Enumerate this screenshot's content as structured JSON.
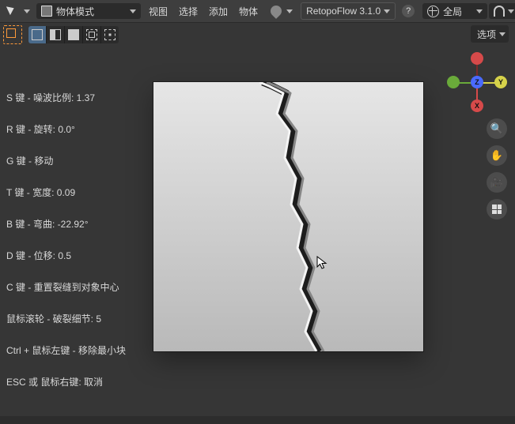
{
  "header": {
    "mode_label": "物体模式",
    "menus": {
      "view": "视图",
      "select": "选择",
      "add": "添加",
      "object": "物体"
    },
    "addon_label": "RetopoFlow 3.1.0",
    "orientation_label": "全局"
  },
  "options": {
    "label": "选项"
  },
  "gizmo": {
    "x": "X",
    "y": "Y",
    "z": "Z"
  },
  "hints": {
    "noise": "S 键 - 噪波比例:  1.37",
    "rotate": "R 键 - 旋转:  0.0°",
    "move": "G 键 - 移动",
    "width": "T 键 - 宽度:  0.09",
    "bend": "B 键 - 弯曲:  -22.92°",
    "offset": "D 键 - 位移:  0.5",
    "reset": "C 键 - 重置裂缝到对象中心",
    "detail": "鼠标滚轮 - 破裂细节:  5",
    "remove": "Ctrl + 鼠标左键 - 移除最小块",
    "cancel": "ESC 或 鼠标右键: 取消"
  }
}
